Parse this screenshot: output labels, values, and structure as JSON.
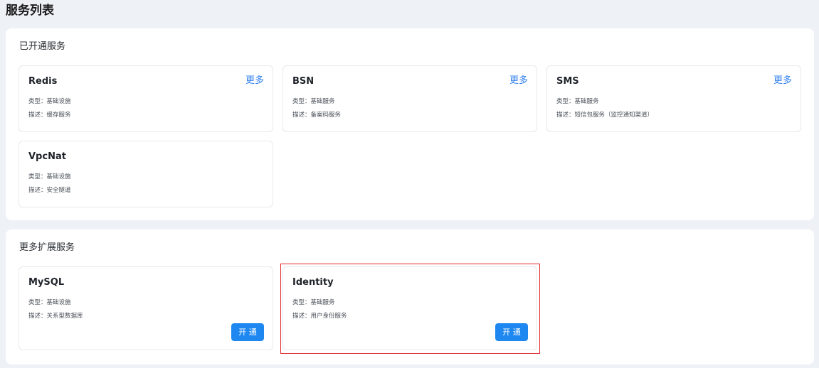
{
  "page": {
    "title": "服务列表"
  },
  "opened": {
    "title": "已开通服务",
    "services": [
      {
        "name": "Redis",
        "more_label": "更多",
        "type": "类型：基础设施",
        "desc": "描述：缓存服务"
      },
      {
        "name": "BSN",
        "more_label": "更多",
        "type": "类型：基础服务",
        "desc": "描述：备案码服务"
      },
      {
        "name": "SMS",
        "more_label": "更多",
        "type": "类型：基础服务",
        "desc": "描述：短信包服务（监控通知渠道）"
      },
      {
        "name": "VpcNat",
        "type": "类型：基础设施",
        "desc": "描述：安全隧道"
      }
    ]
  },
  "more": {
    "title": "更多扩展服务",
    "services": [
      {
        "name": "MySQL",
        "type": "类型：基础设施",
        "desc": "描述：关系型数据库",
        "button_label": "开 通"
      },
      {
        "name": "Identity",
        "type": "类型：基础服务",
        "desc": "描述：用户身份服务",
        "button_label": "开 通"
      }
    ]
  },
  "colors": {
    "accent": "#1e88f0",
    "link": "#2f80ed",
    "highlight": "#e0262b"
  }
}
